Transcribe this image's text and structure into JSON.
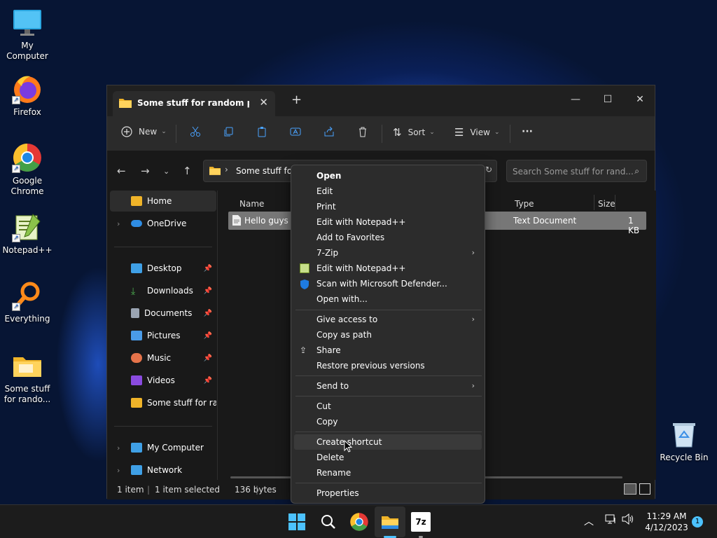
{
  "desktop": {
    "icons": [
      {
        "label": "My Computer",
        "icon": "monitor-icon"
      },
      {
        "label": "Firefox",
        "icon": "firefox-icon"
      },
      {
        "label": "Google Chrome",
        "icon": "chrome-icon"
      },
      {
        "label": "Notepad++",
        "icon": "notepadpp-icon"
      },
      {
        "label": "Everything",
        "icon": "everything-search-icon"
      },
      {
        "label": "Some stuff for rando...",
        "icon": "folder-icon"
      },
      {
        "label": "Recycle Bin",
        "icon": "recycle-bin-icon"
      }
    ]
  },
  "window": {
    "tab_title": "Some stuff for random people",
    "close_tab": "✕",
    "new_tab": "+",
    "controls": {
      "minimize": "—",
      "maximize": "☐",
      "close": "✕"
    },
    "toolbar": {
      "new_label": "New",
      "sort_label": "Sort",
      "view_label": "View",
      "more_label": "···"
    },
    "address_path": "Some stuff for r",
    "search_placeholder": "Search Some stuff for rand...",
    "nav": {
      "home": "Home",
      "onedrive": "OneDrive",
      "desktop": "Desktop",
      "downloads": "Downloads",
      "documents": "Documents",
      "pictures": "Pictures",
      "music": "Music",
      "videos": "Videos",
      "folder": "Some stuff for rand",
      "my_computer": "My Computer",
      "network": "Network"
    },
    "columns": {
      "name": "Name",
      "type": "Type",
      "size": "Size"
    },
    "file": {
      "name": "Hello guys",
      "type": "Text Document",
      "size": "1 KB"
    },
    "status": {
      "items": "1 item",
      "selected": "1 item selected",
      "bytes": "136 bytes"
    }
  },
  "context_menu": {
    "open": "Open",
    "edit": "Edit",
    "print": "Print",
    "edit_npp": "Edit with Notepad++",
    "favorites": "Add to Favorites",
    "zip": "7-Zip",
    "edit_npp2": "Edit with Notepad++",
    "defender": "Scan with Microsoft Defender...",
    "open_with": "Open with...",
    "give_access": "Give access to",
    "copy_path": "Copy as path",
    "share": "Share",
    "restore": "Restore previous versions",
    "send_to": "Send to",
    "cut": "Cut",
    "copy": "Copy",
    "create_shortcut": "Create shortcut",
    "delete": "Delete",
    "rename": "Rename",
    "properties": "Properties"
  },
  "taskbar": {
    "time": "11:29 AM",
    "date": "4/12/2023",
    "notification_count": "1",
    "zip_label": "7z"
  }
}
